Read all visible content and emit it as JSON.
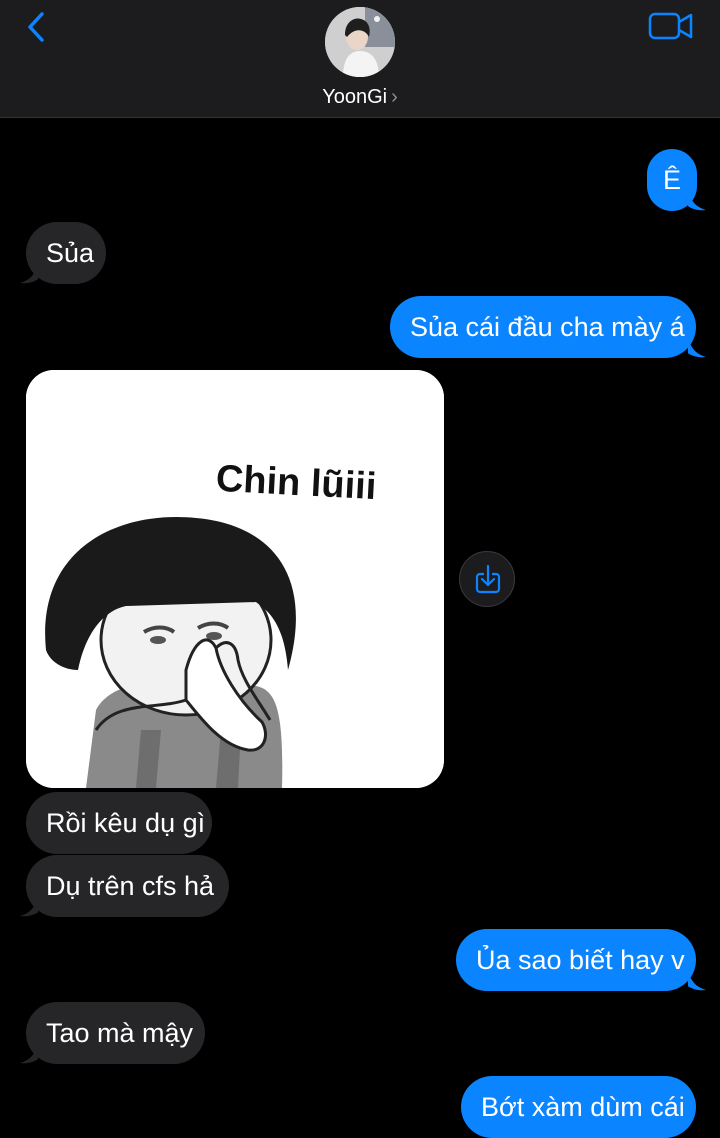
{
  "header": {
    "contact_name": "YoonGi",
    "back_icon": "chevron-left-icon",
    "video_icon": "video-camera-icon",
    "accent_color": "#0a84ff"
  },
  "messages": [
    {
      "side": "out",
      "text": "Ê"
    },
    {
      "side": "in",
      "text": "Sủa"
    },
    {
      "side": "out",
      "text": "Sủa cái đầu cha mày á"
    },
    {
      "side": "in",
      "type": "sticker",
      "sticker_text": "Chin lũiii"
    },
    {
      "side": "in",
      "text": "Rồi kêu dụ gì"
    },
    {
      "side": "in",
      "text": "Dụ trên cfs hả"
    },
    {
      "side": "out",
      "text": "Ủa sao biết hay v"
    },
    {
      "side": "in",
      "text": "Tao mà mậy"
    },
    {
      "side": "out",
      "text": "Bớt xàm dùm cái"
    }
  ],
  "colors": {
    "incoming_bubble": "#262628",
    "outgoing_bubble": "#0a84ff",
    "header_bg": "#1c1c1e"
  }
}
